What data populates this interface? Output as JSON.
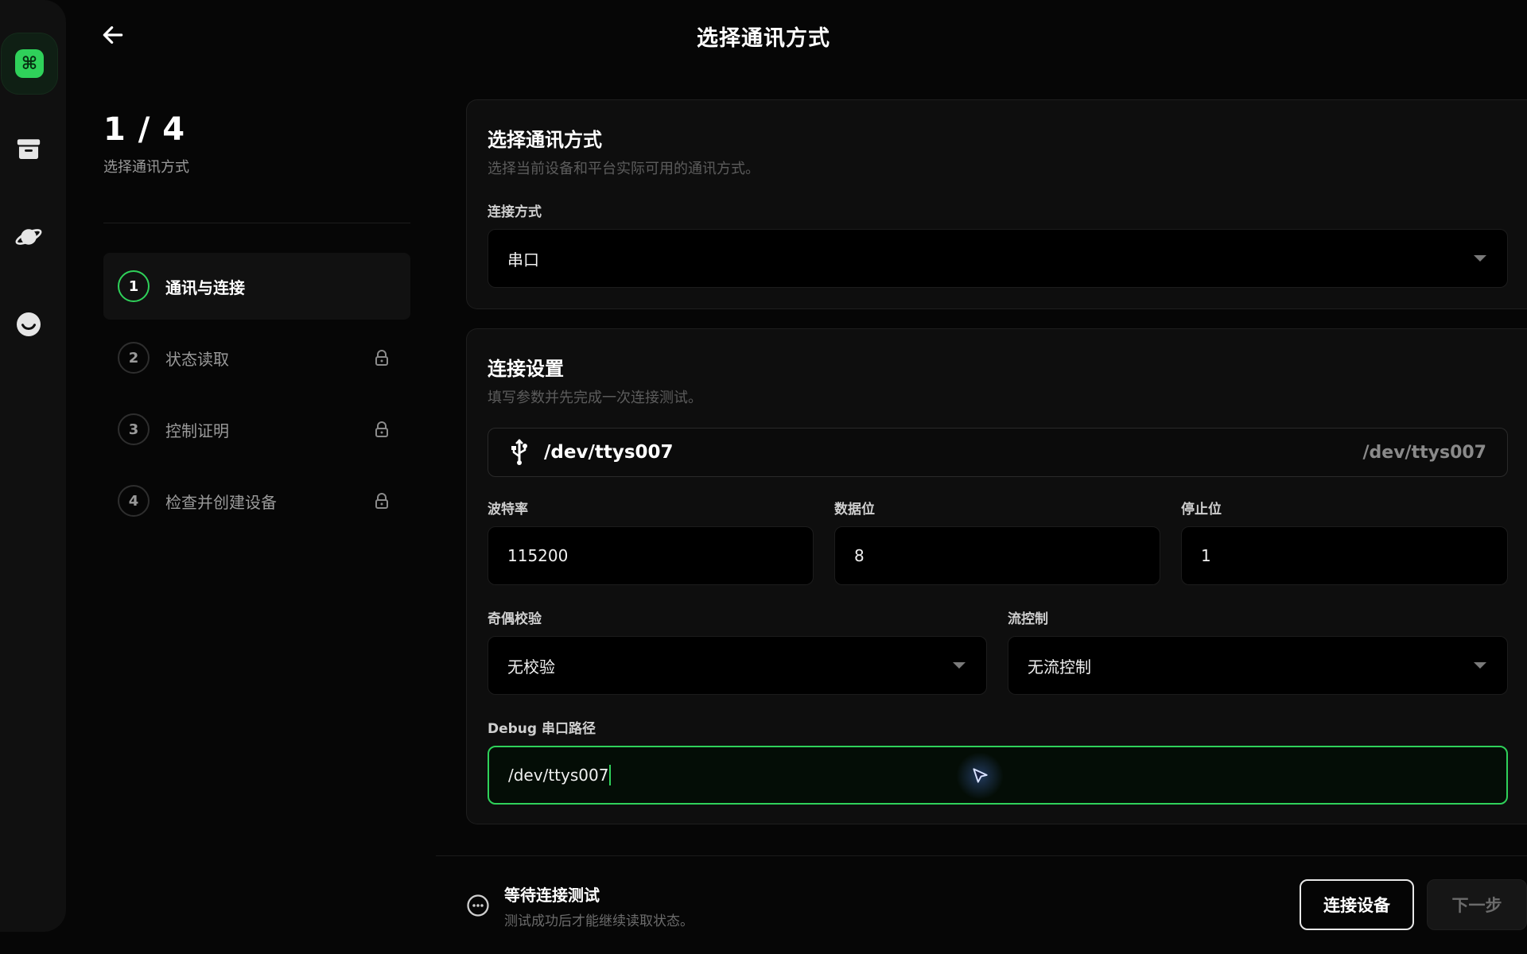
{
  "header": {
    "title": "选择通讯方式",
    "back_icon": "arrow-left-icon"
  },
  "rail": {
    "items": [
      "command-icon",
      "archive-icon",
      "planet-icon",
      "smile-icon"
    ],
    "accent": "#2fd15a"
  },
  "steps": {
    "count": "1 / 4",
    "subtitle": "选择通讯方式",
    "items": [
      {
        "num": "1",
        "label": "通讯与连接",
        "active": true,
        "locked": false
      },
      {
        "num": "2",
        "label": "状态读取",
        "active": false,
        "locked": true
      },
      {
        "num": "3",
        "label": "控制证明",
        "active": false,
        "locked": true
      },
      {
        "num": "4",
        "label": "检查并创建设备",
        "active": false,
        "locked": true
      }
    ]
  },
  "method_card": {
    "title": "选择通讯方式",
    "desc": "选择当前设备和平台实际可用的通讯方式。",
    "field_label": "连接方式",
    "value": "串口"
  },
  "settings_card": {
    "title": "连接设置",
    "desc": "填写参数并先完成一次连接测试。",
    "port": {
      "name": "/dev/ttys007",
      "path": "/dev/ttys007",
      "icon": "usb-icon"
    },
    "baud": {
      "label": "波特率",
      "value": "115200"
    },
    "data_bits": {
      "label": "数据位",
      "value": "8"
    },
    "stop_bits": {
      "label": "停止位",
      "value": "1"
    },
    "parity": {
      "label": "奇偶校验",
      "value": "无校验"
    },
    "flow": {
      "label": "流控制",
      "value": "无流控制"
    },
    "debug": {
      "label": "Debug 串口路径",
      "value": "/dev/ttys007"
    }
  },
  "footer": {
    "status_title": "等待连接测试",
    "status_desc": "测试成功后才能继续读取状态。",
    "connect_label": "连接设备",
    "next_label": "下一步"
  }
}
